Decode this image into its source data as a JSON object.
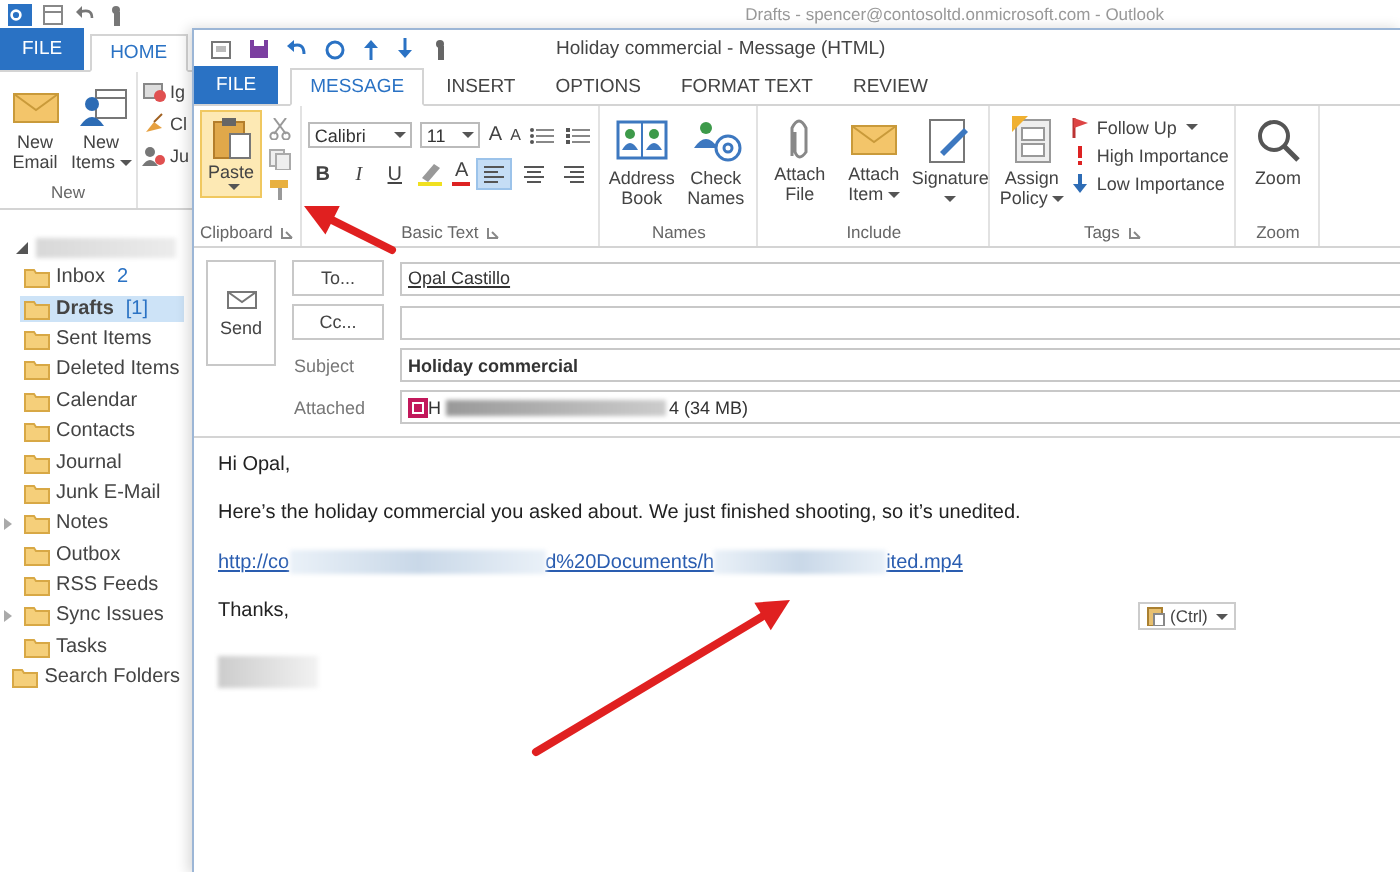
{
  "main_window": {
    "title": "Drafts - spencer@contosoltd.onmicrosoft.com - Outlook",
    "tabs": [
      {
        "label": "FILE",
        "kind": "file",
        "selected": false
      },
      {
        "label": "HOME",
        "kind": "tab",
        "selected": true
      }
    ],
    "ribbon": {
      "group_label": "New",
      "buttons": [
        {
          "label": "New Email",
          "kind": "envelope",
          "dropdown": false
        },
        {
          "label": "New Items",
          "kind": "items",
          "dropdown": true
        }
      ],
      "small_buttons": [
        {
          "label": "Ig",
          "kind": "ignore"
        },
        {
          "label": "Cl",
          "kind": "cleanup"
        },
        {
          "label": "Ju",
          "kind": "junk"
        }
      ]
    },
    "folders": [
      {
        "label": "Inbox",
        "count": "2",
        "selected": false,
        "expandable": false
      },
      {
        "label": "Drafts",
        "count": "[1]",
        "selected": true,
        "expandable": false
      },
      {
        "label": "Sent Items",
        "selected": false,
        "expandable": false
      },
      {
        "label": "Deleted Items",
        "selected": false,
        "expandable": false
      },
      {
        "label": "Calendar",
        "selected": false,
        "expandable": false
      },
      {
        "label": "Contacts",
        "selected": false,
        "expandable": false
      },
      {
        "label": "Journal",
        "selected": false,
        "expandable": false
      },
      {
        "label": "Junk E-Mail",
        "selected": false,
        "expandable": false
      },
      {
        "label": "Notes",
        "selected": false,
        "expandable": true
      },
      {
        "label": "Outbox",
        "selected": false,
        "expandable": false
      },
      {
        "label": "RSS Feeds",
        "selected": false,
        "expandable": false
      },
      {
        "label": "Sync Issues",
        "selected": false,
        "expandable": true
      },
      {
        "label": "Tasks",
        "selected": false,
        "expandable": false
      },
      {
        "label": "Search Folders",
        "selected": false,
        "expandable": false
      }
    ]
  },
  "message_window": {
    "title": "Holiday commercial - Message (HTML)",
    "tabs": [
      {
        "label": "FILE",
        "kind": "file",
        "selected": false
      },
      {
        "label": "MESSAGE",
        "kind": "tab",
        "selected": true
      },
      {
        "label": "INSERT",
        "kind": "tab",
        "selected": false
      },
      {
        "label": "OPTIONS",
        "kind": "tab",
        "selected": false
      },
      {
        "label": "FORMAT TEXT",
        "kind": "tab",
        "selected": false
      },
      {
        "label": "REVIEW",
        "kind": "tab",
        "selected": false
      }
    ],
    "clipboard": {
      "label": "Clipboard",
      "paste": "Paste"
    },
    "basic_text": {
      "label": "Basic Text",
      "font": "Calibri",
      "size": "11",
      "grow": "A",
      "shrink": "A",
      "styles": [
        {
          "label": "B",
          "kind": "bold"
        },
        {
          "label": "I",
          "kind": "italic"
        },
        {
          "label": "U",
          "kind": "underline"
        }
      ],
      "font_color": "A",
      "alignment": [
        {
          "kind": "left",
          "selected": true
        },
        {
          "kind": "center",
          "selected": false
        },
        {
          "kind": "right",
          "selected": false
        }
      ]
    },
    "groups": [
      {
        "label": "Names",
        "buttons": [
          {
            "label": "Address Book",
            "kind": "address_book",
            "dropdown": false
          },
          {
            "label": "Check Names",
            "kind": "check_names",
            "dropdown": false
          }
        ]
      },
      {
        "label": "Include",
        "buttons": [
          {
            "label": "Attach File",
            "kind": "paperclip",
            "dropdown": false
          },
          {
            "label": "Attach Item",
            "kind": "envelope",
            "dropdown": true
          },
          {
            "label": "Signature",
            "kind": "signature",
            "dropdown": true
          }
        ]
      },
      {
        "label": "Tags",
        "buttons": [
          {
            "label": "Assign Policy",
            "kind": "cabinet",
            "dropdown": true
          }
        ],
        "options": [
          {
            "label": "Follow Up",
            "kind": "flag",
            "dropdown": true
          },
          {
            "label": "High Importance",
            "kind": "high",
            "dropdown": false
          },
          {
            "label": "Low Importance",
            "kind": "low",
            "dropdown": false
          }
        ]
      },
      {
        "label": "Zoom",
        "buttons": [
          {
            "label": "Zoom",
            "kind": "zoom",
            "dropdown": false
          }
        ]
      }
    ],
    "compose": {
      "send": "Send",
      "to_button": "To...",
      "cc_button": "Cc...",
      "subject_label": "Subject",
      "attached_label": "Attached",
      "to": "Opal Castillo",
      "subject": "Holiday commercial",
      "attachment_start": "H",
      "attachment_end": "4 (34 MB)"
    },
    "body": {
      "greeting": "Hi Opal,",
      "paragraph": "Here’s the holiday commercial you asked about. We just finished shooting, so it’s unedited.",
      "link_parts": [
        "http://co",
        "d%20Documents/h",
        "ited.mp4"
      ],
      "paste_options": "(Ctrl)",
      "closing": "Thanks,"
    }
  }
}
